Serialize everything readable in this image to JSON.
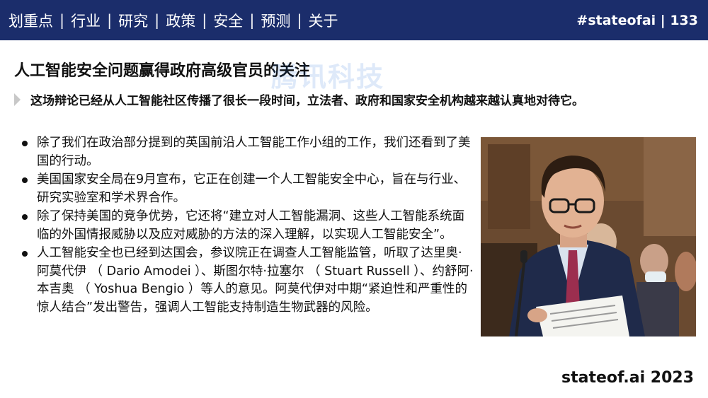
{
  "header": {
    "nav": [
      {
        "label": "划重点"
      },
      {
        "label": "行业"
      },
      {
        "label": "研究"
      },
      {
        "label": "政策"
      },
      {
        "label": "安全"
      },
      {
        "label": "预测"
      },
      {
        "label": "关于"
      }
    ],
    "separator": "|",
    "tag": "#stateofai | 133"
  },
  "watermark": "腾讯科技",
  "title": "人工智能安全问题赢得政府高级官员的关注",
  "subtitle": "这场辩论已经从人工智能社区传播了很长一段时间，立法者、政府和国家安全机构越来越认真地对待它。",
  "bullets": [
    "除了我们在政治部分提到的英国前沿人工智能工作小组的工作，我们还看到了美国的行动。",
    "美国国家安全局在9月宣布，它正在创建一个人工智能安全中心，旨在与行业、研究实验室和学术界合作。",
    "除了保持美国的竞争优势，它还将“建立对人工智能漏洞、这些人工智能系统面临的外国情报威胁以及应对威胁的方法的深入理解，以实现人工智能安全”。",
    "人工智能安全也已经到达国会，参议院正在调查人工智能监管，听取了达里奥·阿莫代伊 （ Dario Amodei ）、斯图尔特·拉塞尔 （ Stuart Russell ）、约舒阿·本吉奥 （ Yoshua Bengio ）等人的意见。阿莫代伊对中期“紧迫性和严重性的惊人结合”发出警告，强调人工智能支持制造生物武器的风险。"
  ],
  "footer": "stateof.ai 2023",
  "colors": {
    "header_bg": "#1b2d6b",
    "header_text": "#ffffff",
    "body_text": "#111111"
  }
}
